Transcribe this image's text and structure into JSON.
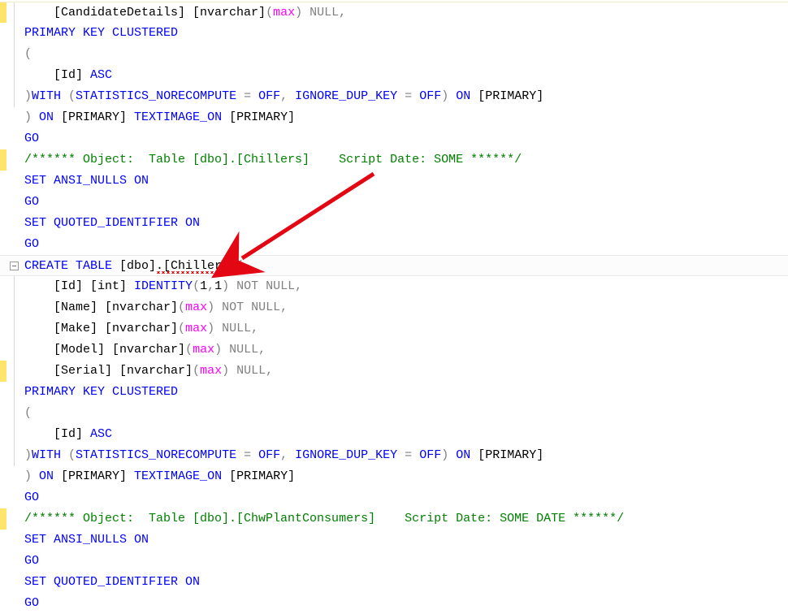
{
  "lines": {
    "l1_col": "[CandidateDetails] [nvarchar]",
    "l1_p1": "(",
    "l1_max": "max",
    "l1_p2": ")",
    "l1_null": " NULL",
    "l1_c": ",",
    "l2": "PRIMARY KEY CLUSTERED",
    "l3": "(",
    "l4_id": "    [Id] ",
    "l4_asc": "ASC",
    "l5_p": ")",
    "l5_w": "WITH ",
    "l5_p2": "(",
    "l5_s": "STATISTICS_NORECOMPUTE ",
    "l5_e1": "=",
    "l5_o1": " OFF",
    "l5_c1": ",",
    "l5_i": " IGNORE_DUP_KEY ",
    "l5_e2": "=",
    "l5_o2": " OFF",
    "l5_p3": ")",
    "l5_on": " ON ",
    "l5_pr": "[PRIMARY]",
    "l6_p": ")",
    "l6_on": " ON ",
    "l6_pr": "[PRIMARY]",
    "l6_ti": " TEXTIMAGE_ON ",
    "l6_pr2": "[PRIMARY]",
    "go": "GO",
    "cmt1": "/****** Object:  Table [dbo].[Chillers]    Script Date: SOME ******/",
    "set1a": "SET",
    "set1b": " ANSI_NULLS ",
    "set1c": "ON",
    "set2a": "SET",
    "set2b": " QUOTED_IDENTIFIER ",
    "set2c": "ON",
    "ct_a": "CREATE",
    "ct_b": " TABLE ",
    "ct_c": "[dbo]",
    "ct_sq": ".[Chillers]",
    "ct_p": "(",
    "col_id_a": "[Id] [int] ",
    "col_id_b": "IDENTITY",
    "col_id_p": "(",
    "col_id_n": "1",
    "col_id_c": ",",
    "col_id_n2": "1",
    "col_id_p2": ")",
    "col_id_nn": " NOT NULL",
    "col_id_cm": ",",
    "col_name_a": "[Name] [nvarchar]",
    "col_name_p": "(",
    "col_name_m": "max",
    "col_name_p2": ")",
    "col_name_nn": " NOT NULL",
    "col_name_cm": ",",
    "col_make_a": "[Make] [nvarchar]",
    "col_make_p": "(",
    "col_make_m": "max",
    "col_make_p2": ")",
    "col_make_n": " NULL",
    "col_make_cm": ",",
    "col_model_a": "[Model] [nvarchar]",
    "col_model_p": "(",
    "col_model_m": "max",
    "col_model_p2": ")",
    "col_model_n": " NULL",
    "col_model_cm": ",",
    "col_serial_a": "[Serial] [nvarchar]",
    "col_serial_p": "(",
    "col_serial_m": "max",
    "col_serial_p2": ")",
    "col_serial_n": " NULL",
    "col_serial_cm": ",",
    "cmt2": "/****** Object:  Table [dbo].[ChwPlantConsumers]    Script Date: SOME DATE ******/"
  }
}
